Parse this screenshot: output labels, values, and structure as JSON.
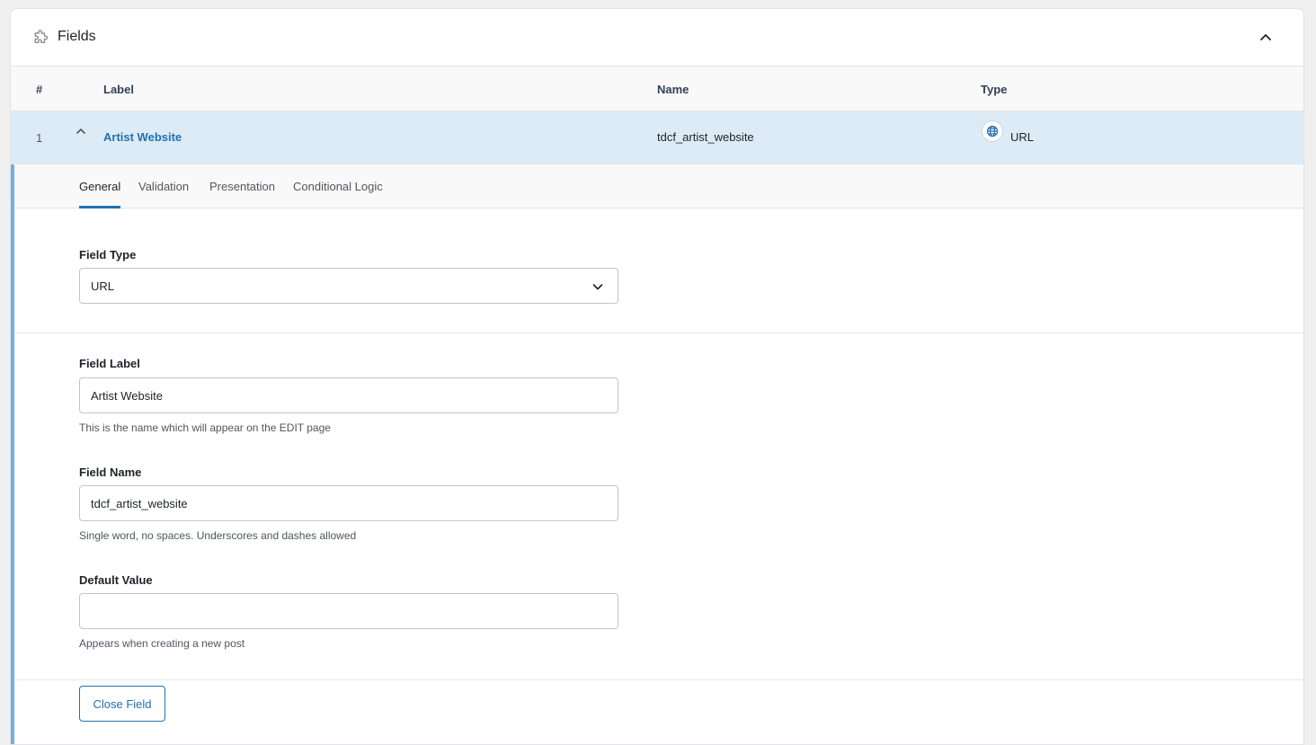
{
  "panel": {
    "title": "Fields",
    "icon": "puzzle-icon",
    "collapse_icon": "chevron-up-icon"
  },
  "columns": {
    "num": "#",
    "label": "Label",
    "name": "Name",
    "type": "Type"
  },
  "field_row": {
    "num": "1",
    "label": "Artist Website",
    "name": "tdcf_artist_website",
    "type": "URL",
    "type_icon": "globe-icon"
  },
  "tabs": {
    "general": "General",
    "validation": "Validation",
    "presentation": "Presentation",
    "conditional": "Conditional Logic",
    "active": "General"
  },
  "form": {
    "field_type_label": "Field Type",
    "field_type_value": "URL",
    "field_label_label": "Field Label",
    "field_label_value": "Artist Website",
    "field_label_help": "This is the name which will appear on the EDIT page",
    "field_name_label": "Field Name",
    "field_name_value": "tdcf_artist_website",
    "field_name_help": "Single word, no spaces. Underscores and dashes allowed",
    "default_value_label": "Default Value",
    "default_value_value": "",
    "default_value_help": "Appears when creating a new post"
  },
  "actions": {
    "close_label": "Close Field"
  },
  "colors": {
    "accent": "#2271b1",
    "row_highlight": "#dcebf5",
    "editor_border": "#72aee6"
  }
}
